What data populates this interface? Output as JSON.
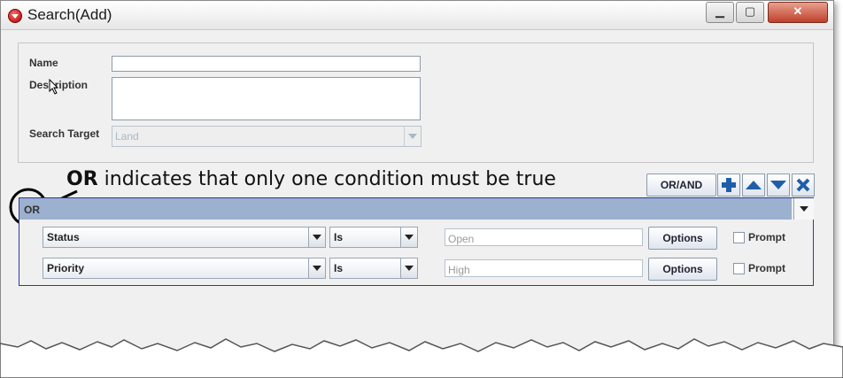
{
  "window": {
    "title": "Search(Add)",
    "controls": {
      "minimize": "▁",
      "maximize": "▢",
      "close": "✕"
    }
  },
  "form": {
    "name_label": "Name",
    "name_value": "",
    "description_label": "Description",
    "description_value": "",
    "search_target_label": "Search Target",
    "search_target_value": "Land"
  },
  "annotation": {
    "keyword": "OR",
    "text": "indicates that only one condition must be true"
  },
  "toolbar": {
    "orand_label": "OR/AND",
    "icons": [
      "plus-icon",
      "arrow-up-icon",
      "arrow-down-icon",
      "delete-x-icon"
    ]
  },
  "group": {
    "operator": "OR",
    "conditions": [
      {
        "field": "Status",
        "operator": "Is",
        "value_placeholder": "Open",
        "options_label": "Options",
        "prompt_label": "Prompt",
        "prompt_checked": false
      },
      {
        "field": "Priority",
        "operator": "Is",
        "value_placeholder": "High",
        "options_label": "Options",
        "prompt_label": "Prompt",
        "prompt_checked": false
      }
    ]
  },
  "colors": {
    "group_header": "#9cb0cf",
    "group_border": "#2b3a9a",
    "icon_blue": "#1f5fa8",
    "close_button": "#c0402a"
  }
}
